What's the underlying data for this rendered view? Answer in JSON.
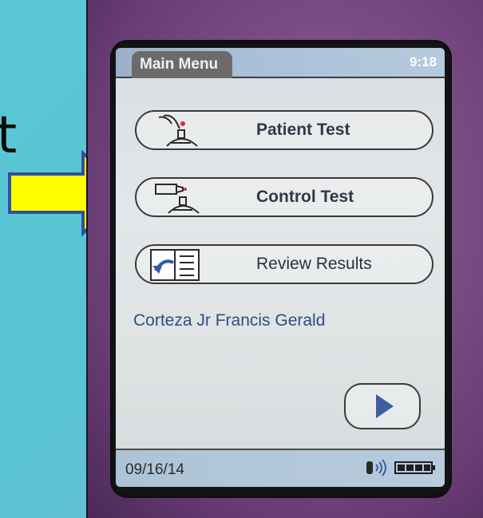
{
  "slide": {
    "fragment_text": "t"
  },
  "screen": {
    "title": "Main Menu",
    "time": "9:18",
    "buttons": {
      "patient_test": "Patient Test",
      "control_test": "Control Test",
      "review_results": "Review Results"
    },
    "patient_name": "Corteza Jr Francis Gerald",
    "date": "09/16/14"
  },
  "icons": {
    "patient_test": "finger-drop-meter-icon",
    "control_test": "control-vial-meter-icon",
    "review_results": "open-book-icon",
    "next": "play-arrow-icon",
    "sound": "speaker-icon",
    "battery": "battery-full-icon"
  },
  "colors": {
    "arrow_fill": "#ffff00",
    "arrow_stroke": "#2f4fa0",
    "title_tab": "#6b6b6b",
    "patient_name": "#2e4f84",
    "next_arrow": "#3d5fa0"
  }
}
